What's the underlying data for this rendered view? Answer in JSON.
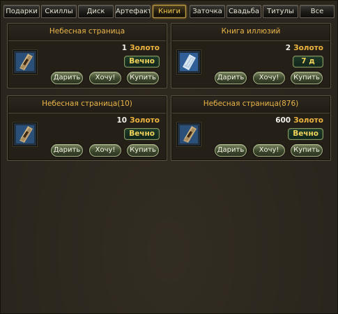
{
  "tabs": [
    {
      "label": "Подарки",
      "active": false
    },
    {
      "label": "Скиллы",
      "active": false
    },
    {
      "label": "Диск",
      "active": false
    },
    {
      "label": "Артефакт",
      "active": false
    },
    {
      "label": "Книги",
      "active": true
    },
    {
      "label": "Заточка",
      "active": false
    },
    {
      "label": "Свадьба",
      "active": false
    },
    {
      "label": "Титулы",
      "active": false
    },
    {
      "label": "Все",
      "active": false
    }
  ],
  "items": [
    {
      "name": "Небесная страница",
      "price": "1",
      "currency": "Золото",
      "duration": "Вечно",
      "icon": "heaven-page-icon",
      "buttons": {
        "gift": "Дарить",
        "want": "Хочу!",
        "buy": "Купить"
      }
    },
    {
      "name": "Книга иллюзий",
      "price": "2",
      "currency": "Золото",
      "duration": "7 д",
      "icon": "illusion-book-icon",
      "buttons": {
        "gift": "Дарить",
        "want": "Хочу!",
        "buy": "Купить"
      }
    },
    {
      "name": "Небесная страница(10)",
      "price": "10",
      "currency": "Золото",
      "duration": "Вечно",
      "icon": "heaven-page-icon",
      "buttons": {
        "gift": "Дарить",
        "want": "Хочу!",
        "buy": "Купить"
      }
    },
    {
      "name": "Небесная страница(876)",
      "price": "600",
      "currency": "Золото",
      "duration": "Вечно",
      "icon": "heaven-page-icon",
      "buttons": {
        "gift": "Дарить",
        "want": "Хочу!",
        "buy": "Купить"
      }
    }
  ],
  "colors": {
    "title": "#eab64a",
    "currency": "#eeb63e",
    "badge_text": "#f0d35a",
    "active_tab": "#f2c94c"
  }
}
